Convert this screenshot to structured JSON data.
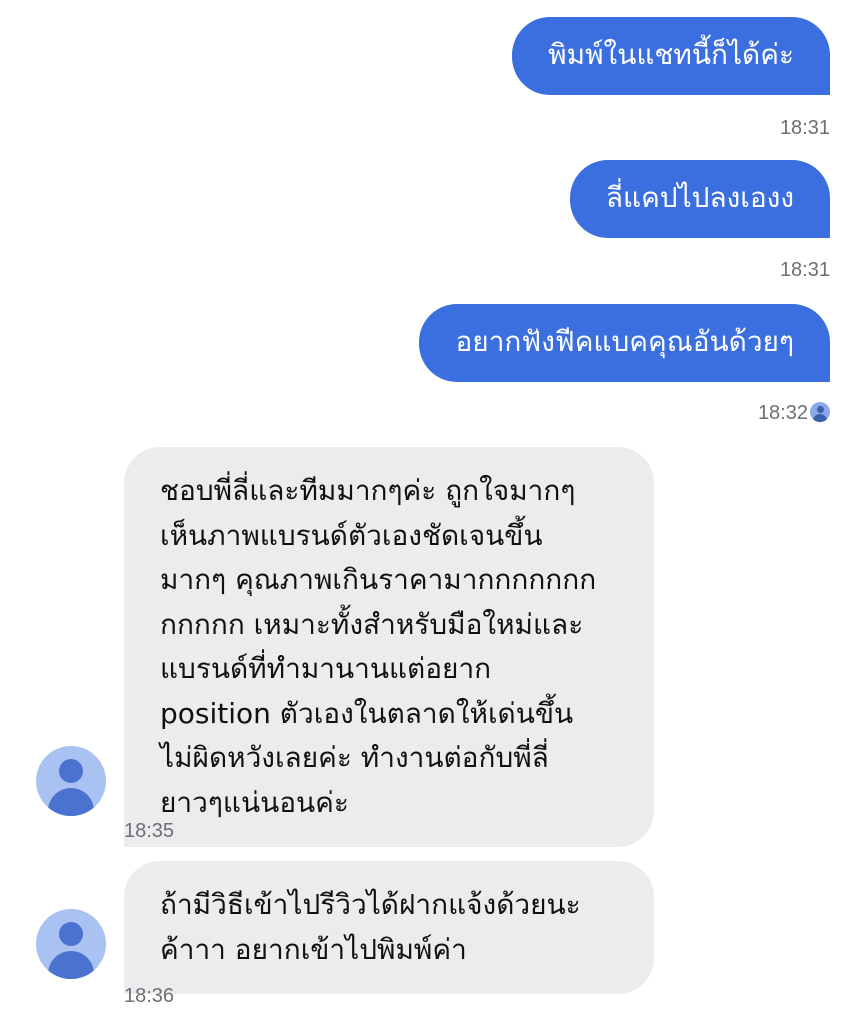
{
  "colors": {
    "outgoing_bubble": "#3b6fe0",
    "incoming_bubble": "#ececef",
    "timestamp_text": "#6e6e73",
    "avatar_bg": "#a9c2f2",
    "avatar_fg": "#4a72cf"
  },
  "messages": [
    {
      "direction": "outgoing",
      "text": "พิมพ์ในแชทนี้ก็ได้ค่ะ",
      "time": "18:31"
    },
    {
      "direction": "outgoing",
      "text": "ลี่แคปไปลงเองง",
      "time": "18:31"
    },
    {
      "direction": "outgoing",
      "text": "อยากฟังฟีคแบคคุณอันด้วยๆ",
      "time": "18:32",
      "seen_icon": "avatar-seen-icon"
    },
    {
      "direction": "incoming",
      "text": "ชอบพี่ลี่และทีมมากๆค่ะ ถูกใจมากๆ\nเห็นภาพแบรนด์ตัวเองชัดเจนขึ้น\nมากๆ คุณภาพเกินราคามากกกกกกก\nกกกกก เหมาะทั้งสำหรับมือใหม่และ\nแบรนด์ที่ทำมานานแต่อยาก\nposition ตัวเองในตลาดให้เด่นขึ้น\nไม่ผิดหวังเลยค่ะ ทำงานต่อกับพี่ลี่\nยาวๆแน่นอนค่ะ",
      "time": "18:35",
      "avatar_icon": "user-avatar-icon"
    },
    {
      "direction": "incoming",
      "text": "ถ้ามีวิธีเข้าไปรีวิวได้ฝากแจ้งด้วยนะ\nค้าาา อยากเข้าไปพิมพ์ค่า",
      "time": "18:36",
      "avatar_icon": "user-avatar-icon"
    }
  ]
}
